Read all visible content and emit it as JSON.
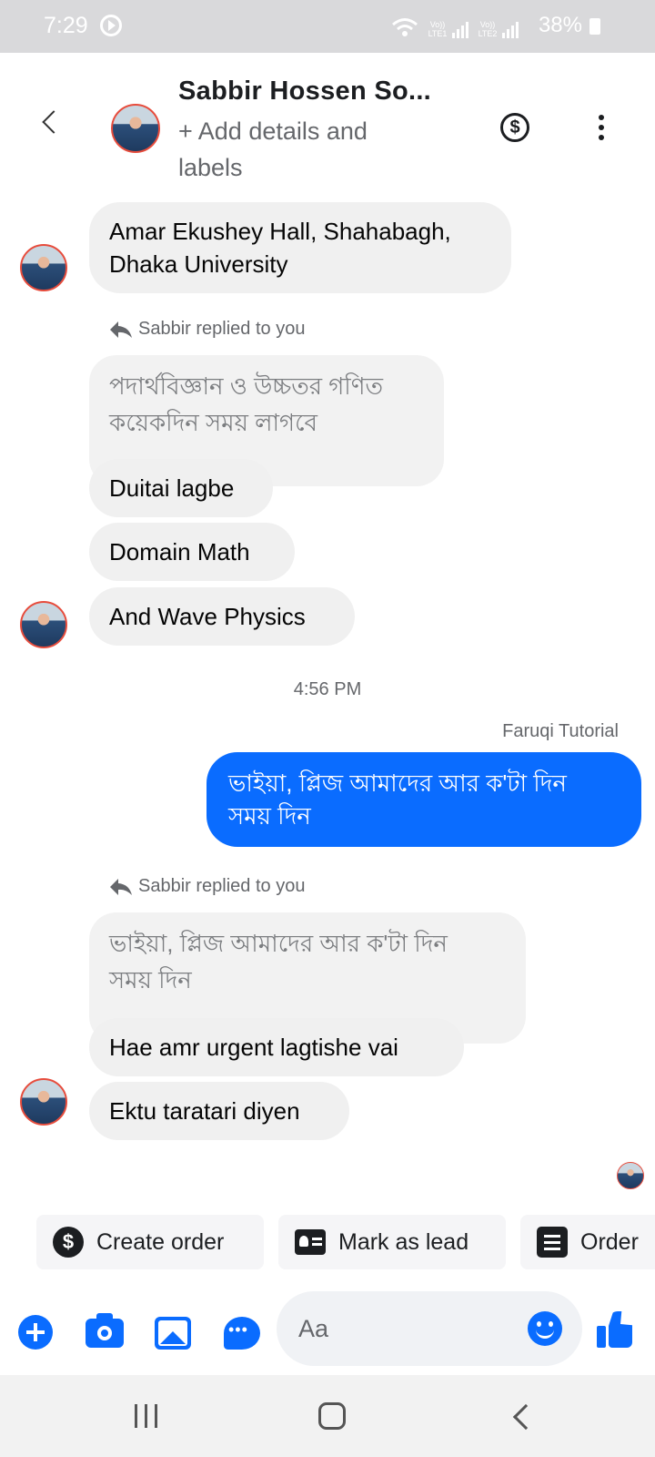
{
  "status_bar": {
    "time": "7:29",
    "battery": "38%",
    "sim1_label": "Vo)) LTE1",
    "sim2_label": "Vo)) LTE2"
  },
  "header": {
    "contact_name": "Sabbir Hossen So...",
    "subtitle": "+ Add details and labels"
  },
  "messages": [
    {
      "side": "in",
      "text_lines": [
        "Amar Ekushey Hall, Shahabagh,",
        "Dhaka University"
      ]
    },
    {
      "reply_label": "Sabbir replied to you",
      "quoted_lines": [
        "পদার্থবিজ্ঞান ও উচ্চতর গণিত",
        "কয়েকদিন সময় লাগবে"
      ],
      "text": "Duitai lagbe"
    },
    {
      "side": "in",
      "text": "Domain Math"
    },
    {
      "side": "in",
      "text": "And Wave Physics"
    },
    {
      "time_separator": "4:56 PM"
    },
    {
      "side": "out",
      "sender": "Faruqi Tutorial",
      "text_lines": [
        "ভাইয়া, প্লিজ আমাদের আর ক'টা দিন",
        "সময় দিন"
      ]
    },
    {
      "reply_label": "Sabbir replied to you",
      "quoted_lines": [
        "ভাইয়া, প্লিজ আমাদের আর ক'টা দিন",
        "সময় দিন"
      ],
      "text": "Hae amr urgent lagtishe vai"
    },
    {
      "side": "in",
      "text": "Ektu taratari diyen"
    }
  ],
  "quick_actions": [
    {
      "label": "Create order",
      "icon": "dollar-circle-icon"
    },
    {
      "label": "Mark as lead",
      "icon": "contact-card-icon"
    },
    {
      "label": "Order",
      "icon": "list-icon"
    }
  ],
  "composer": {
    "placeholder": "Aa"
  },
  "colors": {
    "accent": "#0a6cff",
    "incoming_bubble": "#f0f0f0",
    "secondary_text": "#65676b"
  }
}
